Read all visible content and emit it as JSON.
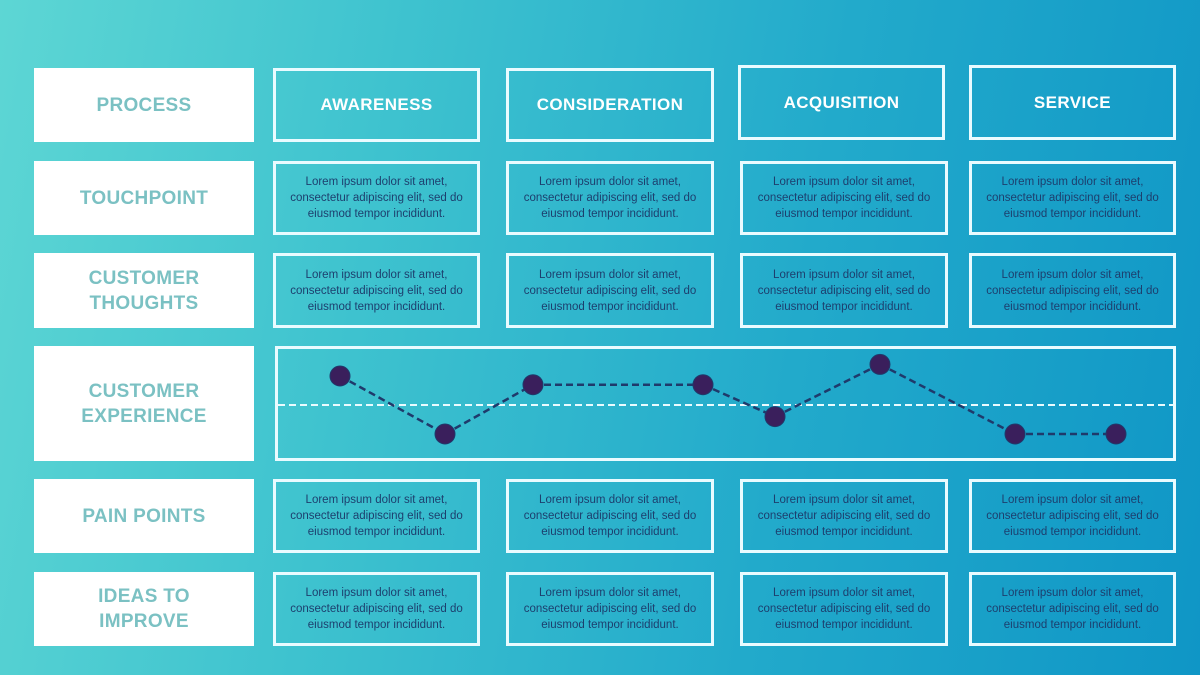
{
  "row_labels": {
    "process": "PROCESS",
    "touchpoint": "TOUCHPOINT",
    "customer_thoughts": "CUSTOMER THOUGHTS",
    "customer_experience": "CUSTOMER EXPERIENCE",
    "pain_points": "PAIN POINTS",
    "ideas_to_improve": "IDEAS TO IMPROVE"
  },
  "stages": [
    "AWARENESS",
    "CONSIDERATION",
    "ACQUISITION",
    "SERVICE"
  ],
  "cell_text": "Lorem ipsum dolor sit amet, consectetur adipiscing elit, sed do eiusmod tempor incididunt.",
  "rows": {
    "touchpoint": [
      "Lorem ipsum dolor sit amet, consectetur adipiscing elit, sed do eiusmod tempor incididunt.",
      "Lorem ipsum dolor sit amet, consectetur adipiscing elit, sed do eiusmod tempor incididunt.",
      "Lorem ipsum dolor sit amet, consectetur adipiscing elit, sed do eiusmod tempor incididunt.",
      "Lorem ipsum dolor sit amet, consectetur adipiscing elit, sed do eiusmod tempor incididunt."
    ],
    "customer_thoughts": [
      "Lorem ipsum dolor sit amet, consectetur adipiscing elit, sed do eiusmod tempor incididunt.",
      "Lorem ipsum dolor sit amet, consectetur adipiscing elit, sed do eiusmod tempor incididunt.",
      "Lorem ipsum dolor sit amet, consectetur adipiscing elit, sed do eiusmod tempor incididunt.",
      "Lorem ipsum dolor sit amet, consectetur adipiscing elit, sed do eiusmod tempor incididunt."
    ],
    "pain_points": [
      "Lorem ipsum dolor sit amet, consectetur adipiscing elit, sed do eiusmod tempor incididunt.",
      "Lorem ipsum dolor sit amet, consectetur adipiscing elit, sed do eiusmod tempor incididunt.",
      "Lorem ipsum dolor sit amet, consectetur adipiscing elit, sed do eiusmod tempor incididunt.",
      "Lorem ipsum dolor sit amet, consectetur adipiscing elit, sed do eiusmod tempor incididunt."
    ],
    "ideas_to_improve": [
      "Lorem ipsum dolor sit amet, consectetur adipiscing elit, sed do eiusmod tempor incididunt.",
      "Lorem ipsum dolor sit amet, consectetur adipiscing elit, sed do eiusmod tempor incididunt.",
      "Lorem ipsum dolor sit amet, consectetur adipiscing elit, sed do eiusmod tempor incididunt.",
      "Lorem ipsum dolor sit amet, consectetur adipiscing elit, sed do eiusmod tempor incididunt."
    ]
  },
  "experience_curve": {
    "description": "Customer sentiment points relative to neutral baseline (positive = above line)",
    "points": [
      0.5,
      -0.5,
      0.35,
      0.35,
      -0.2,
      0.7,
      -0.5,
      -0.5
    ],
    "range": [
      -1,
      1
    ],
    "point_color": "#3a1f5c",
    "line_color": "#1f3a6b",
    "baseline_color": "#e9fbff"
  },
  "colors": {
    "label_text": "#7bc1c3",
    "label_bg": "#ffffff",
    "cell_text": "#1d3f6e",
    "border": "#e9fbff",
    "gradient_start": "#5dd6d4",
    "gradient_end": "#0f96c6"
  }
}
